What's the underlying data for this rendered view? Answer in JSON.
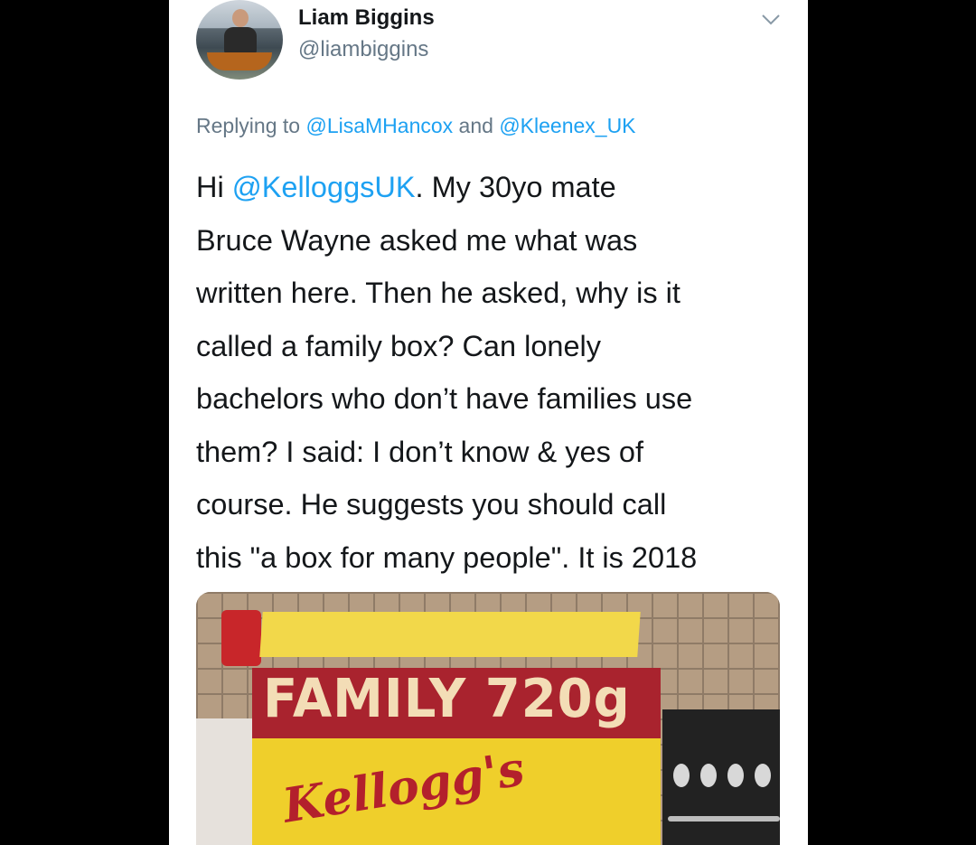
{
  "tweet": {
    "display_name": "Liam Biggins",
    "handle": "@liambiggins",
    "reply": {
      "prefix": "Replying to",
      "mention_1": "@LisaMHancox",
      "joiner": "and",
      "mention_2": "@Kleenex_UK"
    },
    "text": {
      "line1_pre": "Hi ",
      "line1_mention": "@KelloggsUK",
      "line1_post": ". My 30yo mate",
      "line2": "Bruce Wayne asked me what was",
      "line3": "written here. Then he asked, why is it",
      "line4": "called a family box? Can lonely",
      "line5": "bachelors who don’t have families use",
      "line6": "them? I said: I don’t know & yes of",
      "line7": "course. He suggests you should call",
      "line8": "this \"a box for many people\". It is 2018"
    }
  },
  "media": {
    "box_label": "FAMILY 720g",
    "brand": "Kellogg's"
  },
  "colors": {
    "mention": "#1da1f2",
    "secondary_text": "#657786",
    "primary_text": "#14171a"
  },
  "icons": {
    "menu": "chevron-down-icon"
  }
}
